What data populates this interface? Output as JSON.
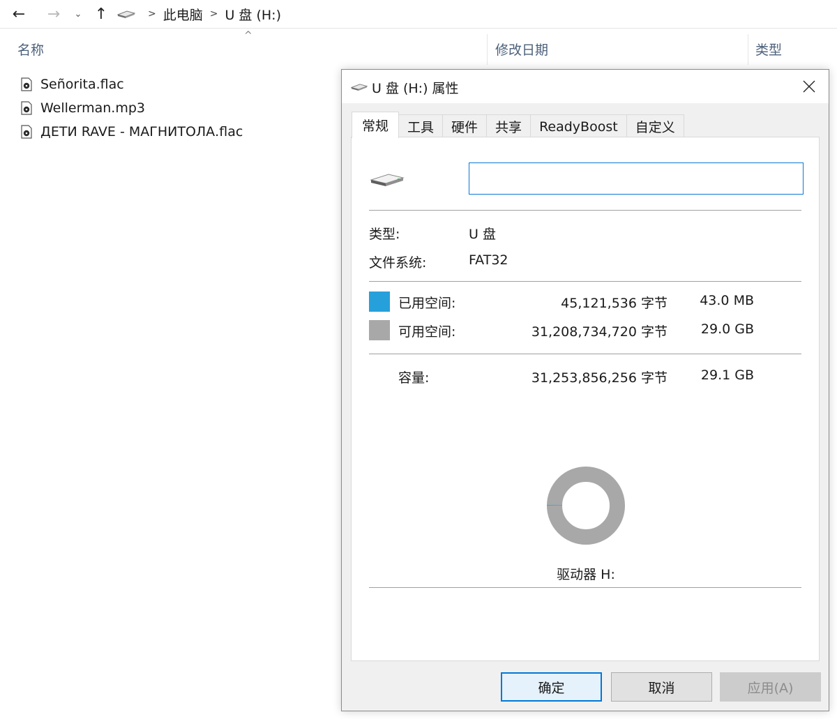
{
  "explorer": {
    "breadcrumb": [
      "此电脑",
      "U 盘 (H:)"
    ],
    "columns": {
      "name": "名称",
      "date": "修改日期",
      "type": "类型"
    },
    "files": [
      {
        "name": "Señorita.flac",
        "icon": "audio-file-icon"
      },
      {
        "name": "Wellerman.mp3",
        "icon": "audio-file-icon"
      },
      {
        "name": "ДЕТИ RAVE - МАГНИТОЛА.flac",
        "icon": "audio-file-icon"
      }
    ]
  },
  "dialog": {
    "title": "U 盘 (H:) 属性",
    "tabs": [
      "常规",
      "工具",
      "硬件",
      "共享",
      "ReadyBoost",
      "自定义"
    ],
    "active_tab": "常规",
    "volume_label_value": "",
    "type_label": "类型:",
    "type_value": "U 盘",
    "fs_label": "文件系统:",
    "fs_value": "FAT32",
    "used": {
      "label": "已用空间:",
      "bytes": "45,121,536 字节",
      "size": "43.0 MB",
      "color": "#26a0da"
    },
    "free": {
      "label": "可用空间:",
      "bytes": "31,208,734,720 字节",
      "size": "29.0 GB",
      "color": "#a8a8a8"
    },
    "capacity": {
      "label": "容量:",
      "bytes": "31,253,856,256 字节",
      "size": "29.1 GB"
    },
    "usage_fraction": 0.0014,
    "drive_label": "驱动器 H:",
    "buttons": {
      "ok": "确定",
      "cancel": "取消",
      "apply": "应用(A)"
    }
  }
}
